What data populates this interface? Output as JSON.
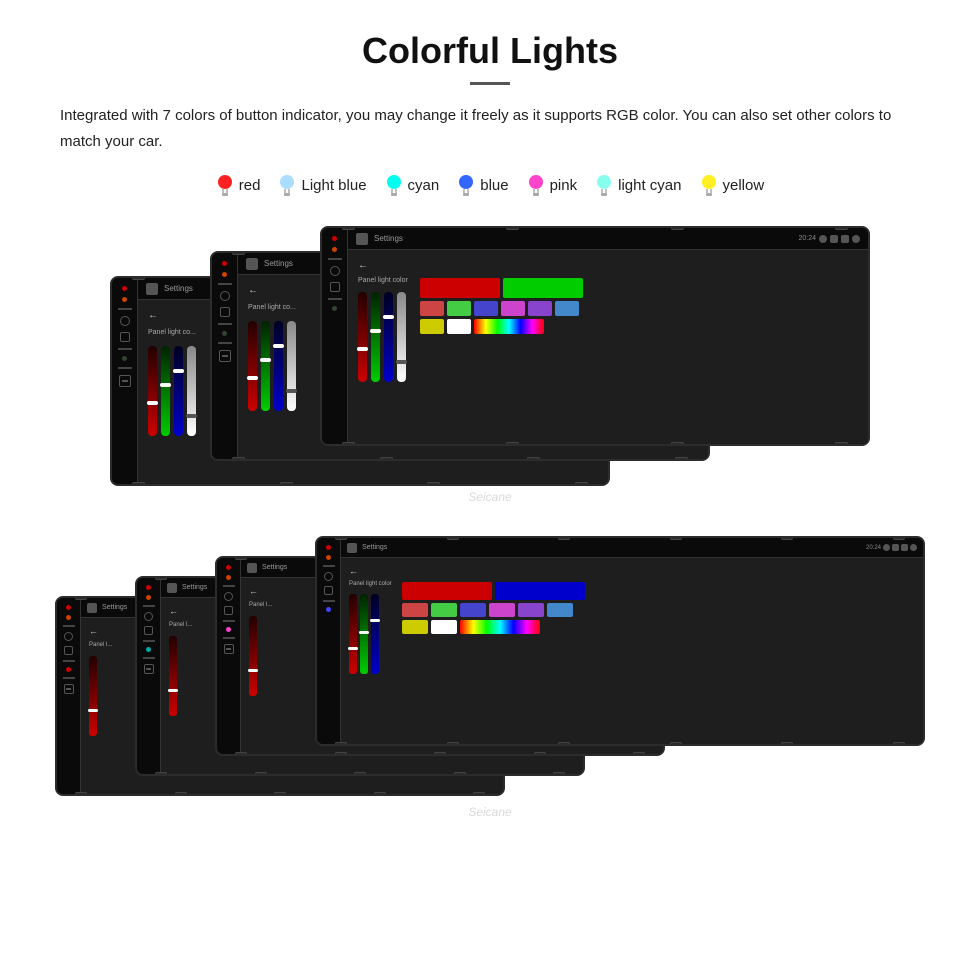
{
  "header": {
    "title": "Colorful Lights",
    "description": "Integrated with 7 colors of button indicator, you may change it freely as it supports RGB color. You can also set other colors to match your car.",
    "divider": "—"
  },
  "colors": [
    {
      "name": "red",
      "color": "#ff2222",
      "glow": "#ff6666"
    },
    {
      "name": "Light blue",
      "color": "#aaddff",
      "glow": "#cceeff"
    },
    {
      "name": "cyan",
      "color": "#00ffee",
      "glow": "#66ffee"
    },
    {
      "name": "blue",
      "color": "#3366ff",
      "glow": "#6699ff"
    },
    {
      "name": "pink",
      "color": "#ff44cc",
      "glow": "#ff88ee"
    },
    {
      "name": "light cyan",
      "color": "#88ffee",
      "glow": "#aaffee"
    },
    {
      "name": "yellow",
      "color": "#ffee22",
      "glow": "#ffee88"
    }
  ],
  "watermark": "Seicane",
  "topRow": {
    "devices": [
      {
        "id": "top-1",
        "sliderColors": [
          "#cc0000",
          "#00cc00",
          "#0000cc",
          "#ffffff"
        ]
      },
      {
        "id": "top-2",
        "sliderColors": [
          "#cc0000",
          "#00cc00",
          "#0000cc",
          "#ffffff"
        ]
      },
      {
        "id": "top-3",
        "sliderColors": [
          "#cc0000",
          "#00cc00",
          "#0000cc",
          "#ffffff"
        ],
        "showColorGrid": true
      }
    ]
  },
  "bottomRow": {
    "devices": [
      {
        "id": "bot-1",
        "accentColor": "#cc0000"
      },
      {
        "id": "bot-2",
        "accentColor": "#cc0000"
      },
      {
        "id": "bot-3",
        "accentColor": "#cc0000"
      },
      {
        "id": "bot-4",
        "showColorGrid": true
      }
    ]
  },
  "colorGridTop": {
    "rows": [
      [
        "#cc0000",
        "#00cc00",
        "#0000cc"
      ],
      [
        "#cc8888",
        "#88cc88",
        "#8888cc"
      ],
      [
        "#cccc00",
        "#ffffff",
        "#ffccff"
      ]
    ]
  },
  "colorGridBottom": {
    "rows": [
      [
        "#cc0000",
        "#00cc00",
        "#0000cc"
      ],
      [
        "#cc8888",
        "#88cc88",
        "#8888cc"
      ],
      [
        "#cccc00",
        "#ffffff",
        "#ffccff"
      ]
    ]
  }
}
